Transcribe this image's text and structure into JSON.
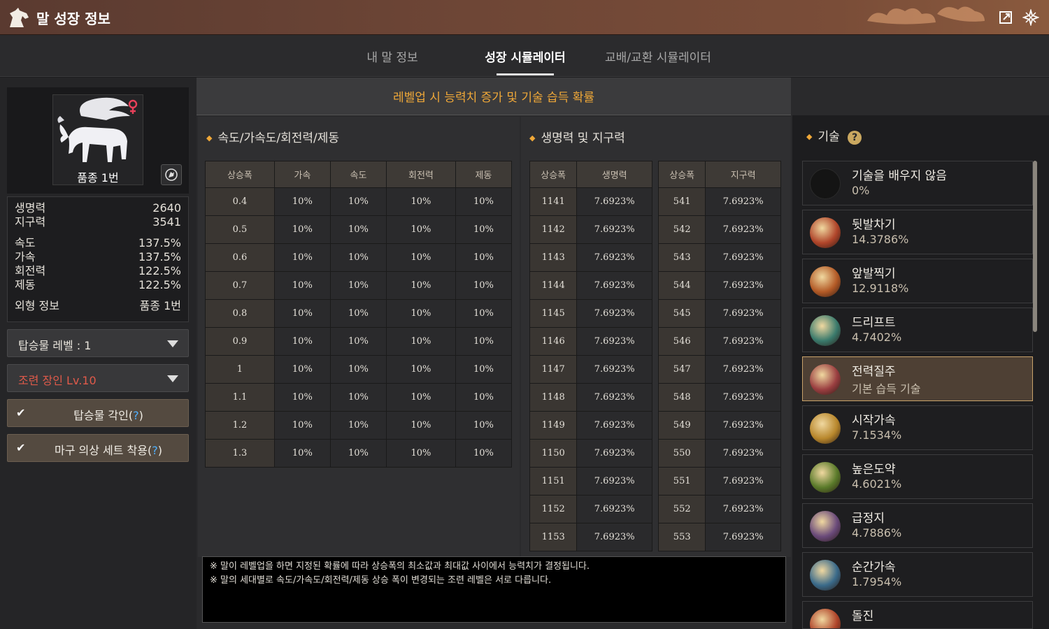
{
  "window": {
    "title": "말 성장 정보"
  },
  "tabs": [
    "내 말 정보",
    "성장 시뮬레이터",
    "교배/교환 시뮬레이터"
  ],
  "horse": {
    "name": "품종 1번"
  },
  "stats": {
    "hp_label": "생명력",
    "hp": "2640",
    "stamina_label": "지구력",
    "stamina": "3541",
    "speed_label": "속도",
    "speed": "137.5%",
    "accel_label": "가속",
    "accel": "137.5%",
    "turn_label": "회전력",
    "turn": "122.5%",
    "brake_label": "제동",
    "brake": "122.5%",
    "appearance_label": "외형 정보",
    "appearance": "품종 1번"
  },
  "controls": {
    "mount_level": "탑승물 레벨 : 1",
    "trainer": "조련 장인 Lv.10",
    "engrave_label": "탑승물 각인(",
    "engrave_q": "?",
    "engrave_end": ")",
    "costume_label": "마구 의상 세트 착용(",
    "costume_q": "?",
    "costume_end": ")"
  },
  "header": "레벨업 시 능력치 증가 및 기술 습득 확률",
  "panel1": {
    "title": "속도/가속도/회전력/제동",
    "columns": [
      "상승폭",
      "가속",
      "속도",
      "회전력",
      "제동"
    ],
    "rows": [
      [
        "0.4",
        "10%",
        "10%",
        "10%",
        "10%"
      ],
      [
        "0.5",
        "10%",
        "10%",
        "10%",
        "10%"
      ],
      [
        "0.6",
        "10%",
        "10%",
        "10%",
        "10%"
      ],
      [
        "0.7",
        "10%",
        "10%",
        "10%",
        "10%"
      ],
      [
        "0.8",
        "10%",
        "10%",
        "10%",
        "10%"
      ],
      [
        "0.9",
        "10%",
        "10%",
        "10%",
        "10%"
      ],
      [
        "1",
        "10%",
        "10%",
        "10%",
        "10%"
      ],
      [
        "1.1",
        "10%",
        "10%",
        "10%",
        "10%"
      ],
      [
        "1.2",
        "10%",
        "10%",
        "10%",
        "10%"
      ],
      [
        "1.3",
        "10%",
        "10%",
        "10%",
        "10%"
      ]
    ]
  },
  "panel2": {
    "title": "생명력 및 지구력",
    "hp_columns": [
      "상승폭",
      "생명력"
    ],
    "hp_rows": [
      [
        "1141",
        "7.6923%"
      ],
      [
        "1142",
        "7.6923%"
      ],
      [
        "1143",
        "7.6923%"
      ],
      [
        "1144",
        "7.6923%"
      ],
      [
        "1145",
        "7.6923%"
      ],
      [
        "1146",
        "7.6923%"
      ],
      [
        "1147",
        "7.6923%"
      ],
      [
        "1148",
        "7.6923%"
      ],
      [
        "1149",
        "7.6923%"
      ],
      [
        "1150",
        "7.6923%"
      ],
      [
        "1151",
        "7.6923%"
      ],
      [
        "1152",
        "7.6923%"
      ],
      [
        "1153",
        "7.6923%"
      ]
    ],
    "st_columns": [
      "상승폭",
      "지구력"
    ],
    "st_rows": [
      [
        "541",
        "7.6923%"
      ],
      [
        "542",
        "7.6923%"
      ],
      [
        "543",
        "7.6923%"
      ],
      [
        "544",
        "7.6923%"
      ],
      [
        "545",
        "7.6923%"
      ],
      [
        "546",
        "7.6923%"
      ],
      [
        "547",
        "7.6923%"
      ],
      [
        "548",
        "7.6923%"
      ],
      [
        "549",
        "7.6923%"
      ],
      [
        "550",
        "7.6923%"
      ],
      [
        "551",
        "7.6923%"
      ],
      [
        "552",
        "7.6923%"
      ],
      [
        "553",
        "7.6923%"
      ]
    ]
  },
  "notes": [
    "※ 말이 레벨업을 하면 지정된 확률에 따라 상승폭의 최소값과 최대값 사이에서 능력치가 결정됩니다.",
    "※ 말의 세대별로 속도/가속도/회전력/제동 상승 폭이 변경되는 조련 레벨은 서로 다릅니다."
  ],
  "skills_panel": {
    "title": "기술",
    "help": "?",
    "items": [
      {
        "name": "기술을 배우지 않음",
        "pct": "0%",
        "color": "#141414",
        "selected": false
      },
      {
        "name": "뒷발차기",
        "pct": "14.3786%",
        "color": "#b0452a",
        "selected": false
      },
      {
        "name": "앞발찍기",
        "pct": "12.9118%",
        "color": "#b35a26",
        "selected": false
      },
      {
        "name": "드리프트",
        "pct": "4.7402%",
        "color": "#3a7a6c",
        "selected": false
      },
      {
        "name": "전력질주",
        "pct": "기본 습득 기술",
        "color": "#9a3e40",
        "selected": true
      },
      {
        "name": "시작가속",
        "pct": "7.1534%",
        "color": "#b8872c",
        "selected": false
      },
      {
        "name": "높은도약",
        "pct": "4.6021%",
        "color": "#5a7a2a",
        "selected": false
      },
      {
        "name": "급정지",
        "pct": "4.7886%",
        "color": "#6a4a7a",
        "selected": false
      },
      {
        "name": "순간가속",
        "pct": "1.7954%",
        "color": "#3a6a8a",
        "selected": false
      },
      {
        "name": "돌진",
        "pct": "",
        "color": "#b0452a",
        "selected": false
      }
    ]
  }
}
